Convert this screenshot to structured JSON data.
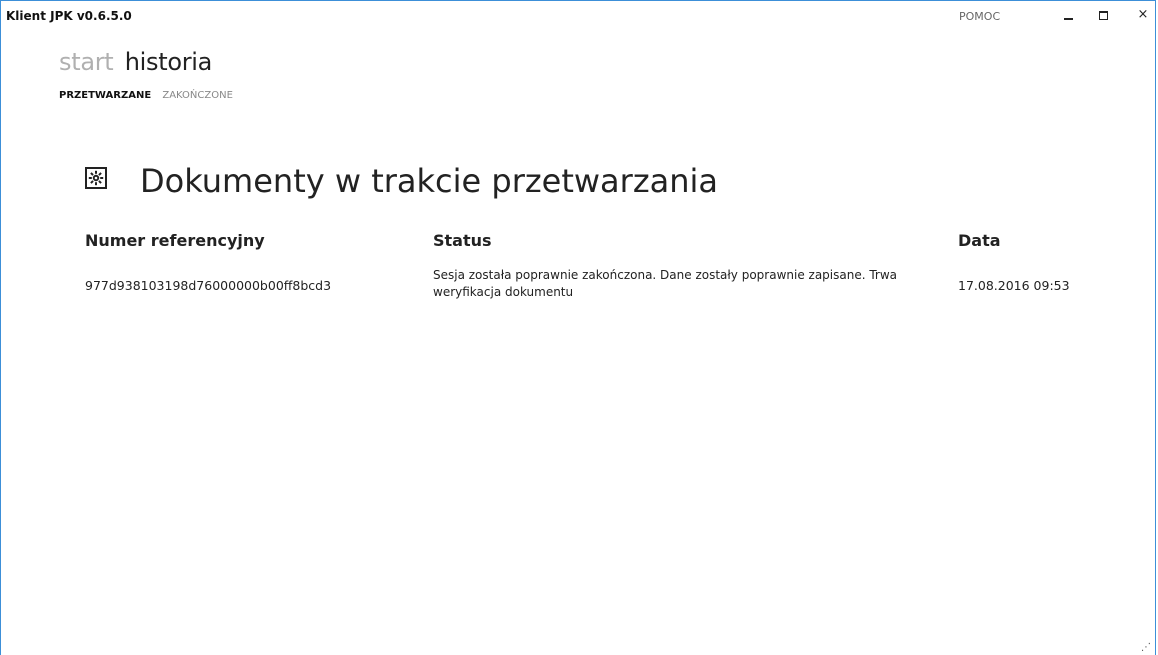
{
  "window": {
    "title": "Klient JPK v0.6.5.0",
    "help_label": "POMOC",
    "minimize_label": "",
    "maximize_label": "",
    "close_label": "×"
  },
  "nav": {
    "primary": [
      {
        "label": "start",
        "active": false
      },
      {
        "label": "historia",
        "active": true
      }
    ],
    "secondary": [
      {
        "label": "PRZETWARZANE",
        "active": true
      },
      {
        "label": "ZAKOŃCZONE",
        "active": false
      }
    ]
  },
  "main": {
    "heading": "Dokumenty w trakcie przetwarzania",
    "heading_icon": "gear-icon",
    "table": {
      "columns": [
        "Numer referencyjny",
        "Status",
        "Data"
      ],
      "rows": [
        {
          "ref": "977d938103198d76000000b00ff8bcd3",
          "status": "Sesja została poprawnie zakończona. Dane zostały poprawnie zapisane. Trwa weryfikacja dokumentu",
          "date": "17.08.2016 09:53"
        }
      ]
    }
  },
  "colors": {
    "window_border": "#3c8fd8",
    "inactive_nav": "#b0b0b0",
    "text": "#222222"
  }
}
